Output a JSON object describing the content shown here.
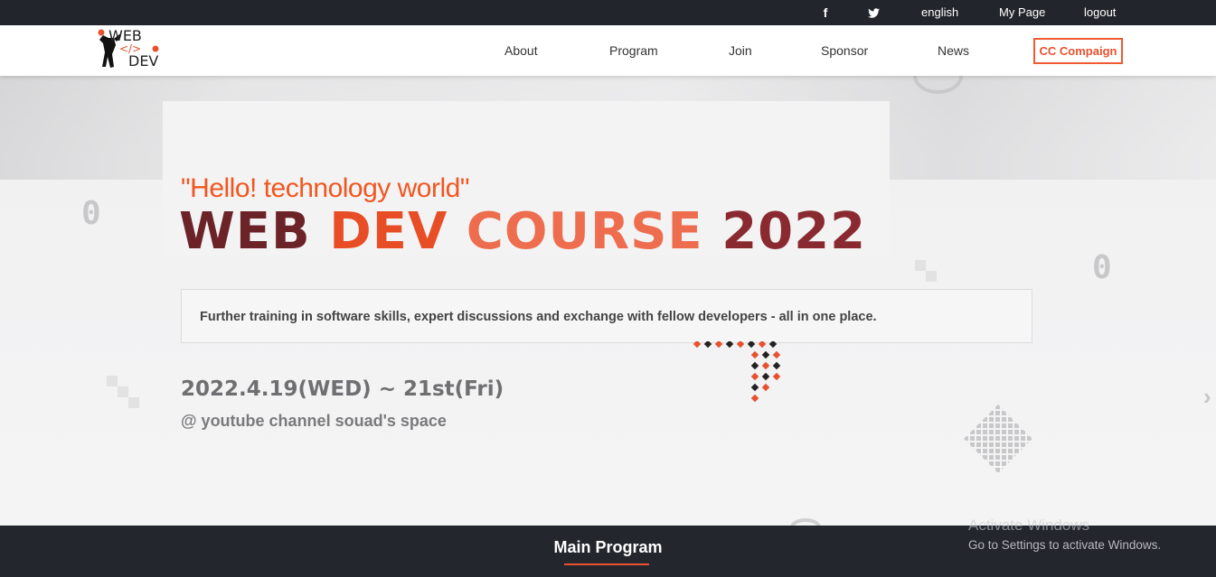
{
  "topbar": {
    "facebook_icon": "facebook-icon",
    "twitter_icon": "twitter-icon",
    "language": "english",
    "my_page": "My Page",
    "logout": "logout"
  },
  "header": {
    "logo": {
      "line1": "WEB",
      "line2": "</>",
      "line3": "DEV"
    },
    "nav": [
      "About",
      "Program",
      "Join",
      "Sponsor",
      "News"
    ],
    "cta": "CC Compaign"
  },
  "hero": {
    "hello": "\"Hello! technology world\"",
    "title_words": [
      "WEB",
      "DEV",
      "COURSE",
      "2022"
    ],
    "description": "Further training in software skills, expert discussions and exchange with fellow developers - all in one place.",
    "date": "2022.4.19(WED) ~ 21st(Fri)",
    "venue": "@ youtube channel souad's space",
    "decor_zero": "0"
  },
  "section": {
    "title": "Main Program"
  },
  "watermark": {
    "title": "Activate Windows",
    "subtitle": "Go to Settings to activate Windows."
  },
  "colors": {
    "accent": "#e8512e",
    "dark": "#22252c",
    "title_dark": "#6b2328"
  }
}
